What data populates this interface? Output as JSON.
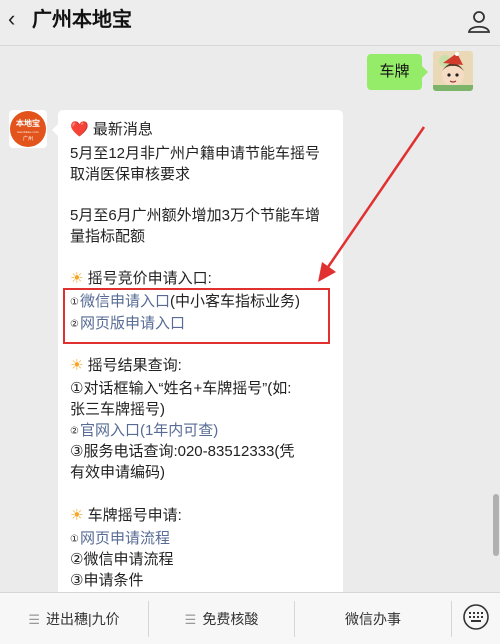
{
  "header": {
    "back_glyph": "‹",
    "title": "广州本地宝",
    "user_icon": "person-icon"
  },
  "chat": {
    "outgoing": {
      "text": "车牌"
    },
    "bot_avatar": {
      "brand": "本地宝",
      "sub": "广州",
      "url": "bendibao.com"
    },
    "incoming": {
      "heart": "❤️",
      "latest_title": "最新消息",
      "news1_line1": "5月至12月非广州户籍申请节能车摇号",
      "news1_line2": "取消医保审核要求",
      "news2_line1": "5月至6月广州额外增加3万个节能车增",
      "news2_line2": "量指标配额",
      "sun": "☀",
      "s1_title": "摇号竞价申请入口:",
      "s1_i1_num": "①",
      "s1_i1_link": "微信申请入口",
      "s1_i1_rest": "(中小客车指标业务)",
      "s1_i2_num": "②",
      "s1_i2_link": "网页版申请入口",
      "s2_title": "摇号结果查询:",
      "s2_i1_line1": "①对话框输入“姓名+车牌摇号”(如:",
      "s2_i1_line2": "张三车牌摇号)",
      "s2_i2_num": "②",
      "s2_i2_link": "官网入口(1年内可查)",
      "s2_i3_line1": "③服务电话查询:020-83512333(凭",
      "s2_i3_line2": "有效申请编码)",
      "s3_title": "车牌摇号申请:",
      "s3_i1_num": "①",
      "s3_i1_link": "网页申请流程",
      "s3_i2": "②微信申请流程",
      "s3_i3": "③申请条件"
    }
  },
  "bottom_menu": {
    "item1": "进出穗|九价",
    "item2": "免费核酸",
    "item3": "微信办事",
    "menu_glyph": "☰",
    "keyboard_icon": "keyboard-icon"
  },
  "colors": {
    "bubble_green": "#95ec69",
    "link_blue": "#576b95",
    "highlight_red": "#e13030"
  }
}
